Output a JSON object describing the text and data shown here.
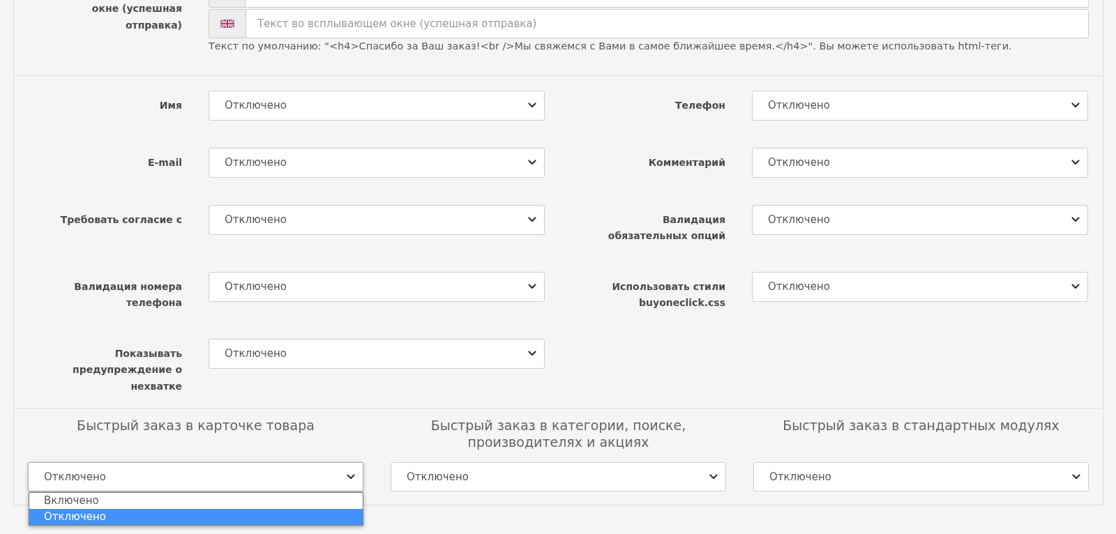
{
  "message_field": {
    "label": "окне (успешная отправка)",
    "placeholder": "Текст во всплывающем окне (успешная отправка)",
    "help": "Текст по умолчанию: \"<h4>Спасибо за Ваш заказ!<br />Мы свяжемся с Вами в самое ближайшее время.</h4>\". Вы можете использовать html-теги."
  },
  "fields": [
    {
      "label": "Имя",
      "value": "Отключено"
    },
    {
      "label": "Телефон",
      "value": "Отключено"
    },
    {
      "label": "E-mail",
      "value": "Отключено"
    },
    {
      "label": "Комментарий",
      "value": "Отключено"
    },
    {
      "label": "Требовать согласие с",
      "value": "Отключено"
    },
    {
      "label": "Валидация обязательных опций",
      "value": "Отключено"
    },
    {
      "label": "Валидация номера телефона",
      "value": "Отключено"
    },
    {
      "label": "Использовать стили buyoneclick.css",
      "value": "Отключено"
    },
    {
      "label": "Показывать предупреждение о нехватке",
      "value": "Отключено"
    }
  ],
  "quick_order": [
    {
      "heading": "Быстрый заказ в карточке товара",
      "value": "Отключено",
      "expanded": true,
      "options": [
        {
          "label": "Включено",
          "selected": false
        },
        {
          "label": "Отключено",
          "selected": true
        }
      ]
    },
    {
      "heading": "Быстрый заказ в категории, поиске, производителях и акциях",
      "value": "Отключено",
      "expanded": false
    },
    {
      "heading": "Быстрый заказ в стандартных модулях",
      "value": "Отключено",
      "expanded": false
    }
  ]
}
